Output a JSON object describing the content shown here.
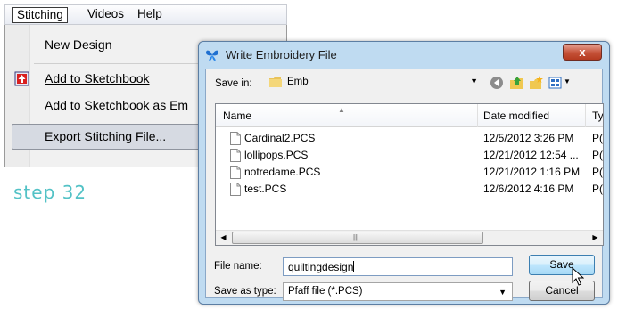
{
  "menubar": {
    "items": [
      {
        "label": "Stitching"
      },
      {
        "label": "Videos"
      },
      {
        "label": "Help"
      }
    ]
  },
  "menu": {
    "new_design": "New Design",
    "add_sketchbook": "Add to Sketchbook",
    "add_sketchbook_as": "Add to Sketchbook as Em",
    "export": "Export Stitching File..."
  },
  "caption": "step 32",
  "dialog": {
    "title": "Write Embroidery File",
    "close_label": "x",
    "save_in_label": "Save in:",
    "save_in_value": "Emb",
    "columns": {
      "name": "Name",
      "date": "Date modified",
      "type": "Ty"
    },
    "files": [
      {
        "name": "Cardinal2.PCS",
        "date": "12/5/2012 3:26 PM",
        "type": "P("
      },
      {
        "name": "lollipops.PCS",
        "date": "12/21/2012 12:54 ...",
        "type": "P("
      },
      {
        "name": "notredame.PCS",
        "date": "12/21/2012 1:16 PM",
        "type": "P("
      },
      {
        "name": "test.PCS",
        "date": "12/6/2012 4:16 PM",
        "type": "P("
      }
    ],
    "file_name_label": "File name:",
    "file_name_value": "quiltingdesign",
    "save_type_label": "Save as type:",
    "save_type_value": "Pfaff file (*.PCS)",
    "save_button": "Save",
    "cancel_button": "Cancel"
  },
  "colors": {
    "caption": "#53c2c6",
    "dialog_frame": "#bfdbf1",
    "close_button": "#c55138"
  },
  "icons": [
    "sketchbook-icon",
    "butterfly-icon",
    "folder-icon",
    "back-icon",
    "up-folder-icon",
    "new-folder-icon",
    "views-icon",
    "file-icon",
    "mouse-cursor-icon"
  ]
}
